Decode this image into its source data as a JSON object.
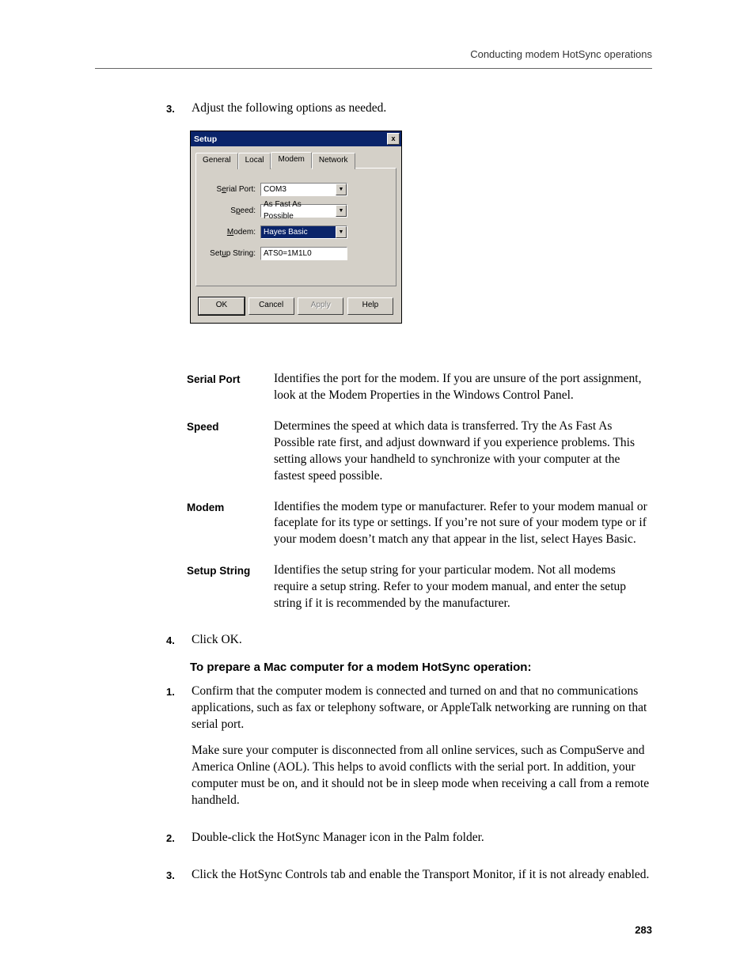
{
  "running_header": "Conducting modem HotSync operations",
  "step3_num": "3.",
  "step3_text": "Adjust the following options as needed.",
  "dialog": {
    "title": "Setup",
    "close": "x",
    "tabs": {
      "general": "General",
      "local": "Local",
      "modem": "Modem",
      "network": "Network"
    },
    "labels": {
      "serial_port_pre": "S",
      "serial_port_u": "e",
      "serial_port_post": "rial Port:",
      "speed_pre": "S",
      "speed_u": "p",
      "speed_post": "eed:",
      "modem_pre": "",
      "modem_u": "M",
      "modem_post": "odem:",
      "setup_pre": "Set",
      "setup_u": "u",
      "setup_post": "p String:"
    },
    "values": {
      "serial_port": "COM3",
      "speed": "As Fast As Possible",
      "modem": "Hayes Basic",
      "setup_string": "ATS0=1M1L0"
    },
    "dropdown_glyph": "▼",
    "buttons": {
      "ok": "OK",
      "cancel": "Cancel",
      "apply": "Apply",
      "help": "Help"
    }
  },
  "definitions": [
    {
      "term": "Serial Port",
      "desc": "Identifies the port for the modem. If you are unsure of the port assignment, look at the Modem Properties in the Windows Control Panel."
    },
    {
      "term": "Speed",
      "desc": "Determines the speed at which data is transferred. Try the As Fast As Possible rate first, and adjust downward if you experience problems. This setting allows your handheld to synchronize with your computer at the fastest speed possible."
    },
    {
      "term": "Modem",
      "desc": "Identifies the modem type or manufacturer. Refer to your modem manual or faceplate for its type or settings. If you’re not sure of your modem type or if your modem doesn’t match any that appear in the list, select Hayes Basic."
    },
    {
      "term": "Setup String",
      "desc": "Identifies the setup string for your particular modem. Not all modems require a setup string. Refer to your modem manual, and enter the setup string if it is recommended by the manufacturer."
    }
  ],
  "step4_num": "4.",
  "step4_text": "Click OK.",
  "sub_heading": "To prepare a Mac computer for a modem HotSync operation:",
  "mac_steps": [
    {
      "num": "1.",
      "para1": "Confirm that the computer modem is connected and turned on and that no communications applications, such as fax or telephony software, or AppleTalk networking are running on that serial port.",
      "para2": "Make sure your computer is disconnected from all online services, such as CompuServe and America Online (AOL). This helps to avoid conflicts with the serial port. In addition, your computer must be on, and it should not be in sleep mode when receiving a call from a remote handheld."
    },
    {
      "num": "2.",
      "para1": "Double-click the HotSync Manager icon in the Palm folder."
    },
    {
      "num": "3.",
      "para1": "Click the HotSync Controls tab and enable the Transport Monitor, if it is not already enabled."
    }
  ],
  "page_number": "283"
}
